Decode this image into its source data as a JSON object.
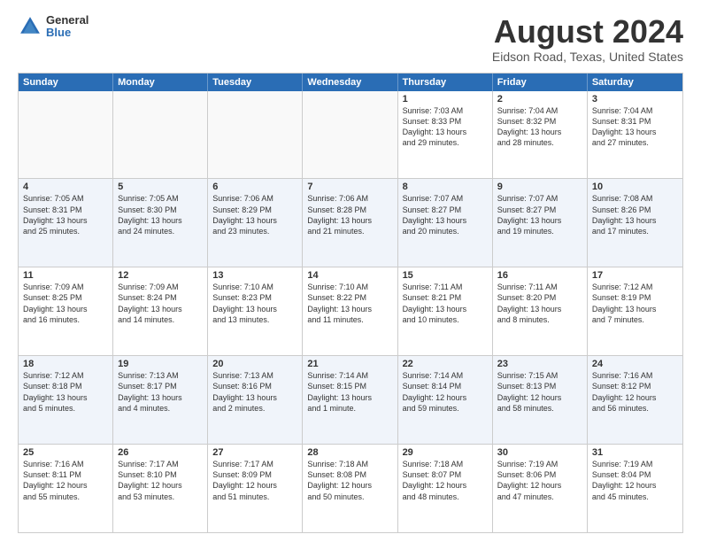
{
  "logo": {
    "general": "General",
    "blue": "Blue"
  },
  "title": "August 2024",
  "subtitle": "Eidson Road, Texas, United States",
  "headers": [
    "Sunday",
    "Monday",
    "Tuesday",
    "Wednesday",
    "Thursday",
    "Friday",
    "Saturday"
  ],
  "rows": [
    [
      {
        "day": "",
        "lines": []
      },
      {
        "day": "",
        "lines": []
      },
      {
        "day": "",
        "lines": []
      },
      {
        "day": "",
        "lines": []
      },
      {
        "day": "1",
        "lines": [
          "Sunrise: 7:03 AM",
          "Sunset: 8:33 PM",
          "Daylight: 13 hours",
          "and 29 minutes."
        ]
      },
      {
        "day": "2",
        "lines": [
          "Sunrise: 7:04 AM",
          "Sunset: 8:32 PM",
          "Daylight: 13 hours",
          "and 28 minutes."
        ]
      },
      {
        "day": "3",
        "lines": [
          "Sunrise: 7:04 AM",
          "Sunset: 8:31 PM",
          "Daylight: 13 hours",
          "and 27 minutes."
        ]
      }
    ],
    [
      {
        "day": "4",
        "lines": [
          "Sunrise: 7:05 AM",
          "Sunset: 8:31 PM",
          "Daylight: 13 hours",
          "and 25 minutes."
        ]
      },
      {
        "day": "5",
        "lines": [
          "Sunrise: 7:05 AM",
          "Sunset: 8:30 PM",
          "Daylight: 13 hours",
          "and 24 minutes."
        ]
      },
      {
        "day": "6",
        "lines": [
          "Sunrise: 7:06 AM",
          "Sunset: 8:29 PM",
          "Daylight: 13 hours",
          "and 23 minutes."
        ]
      },
      {
        "day": "7",
        "lines": [
          "Sunrise: 7:06 AM",
          "Sunset: 8:28 PM",
          "Daylight: 13 hours",
          "and 21 minutes."
        ]
      },
      {
        "day": "8",
        "lines": [
          "Sunrise: 7:07 AM",
          "Sunset: 8:27 PM",
          "Daylight: 13 hours",
          "and 20 minutes."
        ]
      },
      {
        "day": "9",
        "lines": [
          "Sunrise: 7:07 AM",
          "Sunset: 8:27 PM",
          "Daylight: 13 hours",
          "and 19 minutes."
        ]
      },
      {
        "day": "10",
        "lines": [
          "Sunrise: 7:08 AM",
          "Sunset: 8:26 PM",
          "Daylight: 13 hours",
          "and 17 minutes."
        ]
      }
    ],
    [
      {
        "day": "11",
        "lines": [
          "Sunrise: 7:09 AM",
          "Sunset: 8:25 PM",
          "Daylight: 13 hours",
          "and 16 minutes."
        ]
      },
      {
        "day": "12",
        "lines": [
          "Sunrise: 7:09 AM",
          "Sunset: 8:24 PM",
          "Daylight: 13 hours",
          "and 14 minutes."
        ]
      },
      {
        "day": "13",
        "lines": [
          "Sunrise: 7:10 AM",
          "Sunset: 8:23 PM",
          "Daylight: 13 hours",
          "and 13 minutes."
        ]
      },
      {
        "day": "14",
        "lines": [
          "Sunrise: 7:10 AM",
          "Sunset: 8:22 PM",
          "Daylight: 13 hours",
          "and 11 minutes."
        ]
      },
      {
        "day": "15",
        "lines": [
          "Sunrise: 7:11 AM",
          "Sunset: 8:21 PM",
          "Daylight: 13 hours",
          "and 10 minutes."
        ]
      },
      {
        "day": "16",
        "lines": [
          "Sunrise: 7:11 AM",
          "Sunset: 8:20 PM",
          "Daylight: 13 hours",
          "and 8 minutes."
        ]
      },
      {
        "day": "17",
        "lines": [
          "Sunrise: 7:12 AM",
          "Sunset: 8:19 PM",
          "Daylight: 13 hours",
          "and 7 minutes."
        ]
      }
    ],
    [
      {
        "day": "18",
        "lines": [
          "Sunrise: 7:12 AM",
          "Sunset: 8:18 PM",
          "Daylight: 13 hours",
          "and 5 minutes."
        ]
      },
      {
        "day": "19",
        "lines": [
          "Sunrise: 7:13 AM",
          "Sunset: 8:17 PM",
          "Daylight: 13 hours",
          "and 4 minutes."
        ]
      },
      {
        "day": "20",
        "lines": [
          "Sunrise: 7:13 AM",
          "Sunset: 8:16 PM",
          "Daylight: 13 hours",
          "and 2 minutes."
        ]
      },
      {
        "day": "21",
        "lines": [
          "Sunrise: 7:14 AM",
          "Sunset: 8:15 PM",
          "Daylight: 13 hours",
          "and 1 minute."
        ]
      },
      {
        "day": "22",
        "lines": [
          "Sunrise: 7:14 AM",
          "Sunset: 8:14 PM",
          "Daylight: 12 hours",
          "and 59 minutes."
        ]
      },
      {
        "day": "23",
        "lines": [
          "Sunrise: 7:15 AM",
          "Sunset: 8:13 PM",
          "Daylight: 12 hours",
          "and 58 minutes."
        ]
      },
      {
        "day": "24",
        "lines": [
          "Sunrise: 7:16 AM",
          "Sunset: 8:12 PM",
          "Daylight: 12 hours",
          "and 56 minutes."
        ]
      }
    ],
    [
      {
        "day": "25",
        "lines": [
          "Sunrise: 7:16 AM",
          "Sunset: 8:11 PM",
          "Daylight: 12 hours",
          "and 55 minutes."
        ]
      },
      {
        "day": "26",
        "lines": [
          "Sunrise: 7:17 AM",
          "Sunset: 8:10 PM",
          "Daylight: 12 hours",
          "and 53 minutes."
        ]
      },
      {
        "day": "27",
        "lines": [
          "Sunrise: 7:17 AM",
          "Sunset: 8:09 PM",
          "Daylight: 12 hours",
          "and 51 minutes."
        ]
      },
      {
        "day": "28",
        "lines": [
          "Sunrise: 7:18 AM",
          "Sunset: 8:08 PM",
          "Daylight: 12 hours",
          "and 50 minutes."
        ]
      },
      {
        "day": "29",
        "lines": [
          "Sunrise: 7:18 AM",
          "Sunset: 8:07 PM",
          "Daylight: 12 hours",
          "and 48 minutes."
        ]
      },
      {
        "day": "30",
        "lines": [
          "Sunrise: 7:19 AM",
          "Sunset: 8:06 PM",
          "Daylight: 12 hours",
          "and 47 minutes."
        ]
      },
      {
        "day": "31",
        "lines": [
          "Sunrise: 7:19 AM",
          "Sunset: 8:04 PM",
          "Daylight: 12 hours",
          "and 45 minutes."
        ]
      }
    ]
  ]
}
